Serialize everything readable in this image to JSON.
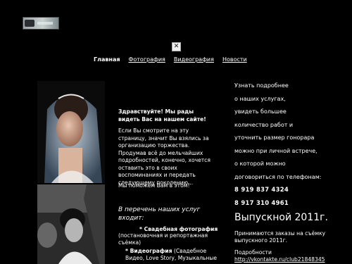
{
  "nav": {
    "items": [
      "Главная",
      "Фотография",
      "Видеография",
      "Новости"
    ]
  },
  "close_glyph": "✕",
  "main": {
    "welcome": "Здравствуйте! Мы рады видеть Вас на нашем сайте!",
    "intro": "Если Вы смотрите на эту страницу, значит  Вы взялись за организацию торжества. Продумав всё до мельчайших подробностей, конечно, хочется оставить это в своих воспоминаниях и передать следующему поколению...",
    "help": "Мы поможем Вам в этом!",
    "services_title": "В перечень наших услуг входит:",
    "service1_title": "* Свадебная фотография",
    "service1_desc": "(постановочная и репортажная съёмка)",
    "service2_title": "* Видеография",
    "service2_desc": "(Свадебное Видео, Love Story, Музыкальные"
  },
  "contact": {
    "lines": [
      "Узнать подробнее",
      "о наших услугах,",
      "увидеть большее",
      "количество работ и",
      "уточнить размер гонорара",
      "можно при личной встрече,",
      "о которой можно",
      "договориться по телефонам:"
    ],
    "phones": [
      "8 919 837 4324",
      "8 917 310 4961"
    ]
  },
  "graduation": {
    "title": "Выпускной 2011г.",
    "desc": "Принимаются заказы на съёмку выпускного 2011г.",
    "details_label": "Подробности",
    "link": "http://vkontakte.ru/club21848345"
  },
  "colors": {
    "background": "#000000",
    "text": "#ffffff"
  }
}
